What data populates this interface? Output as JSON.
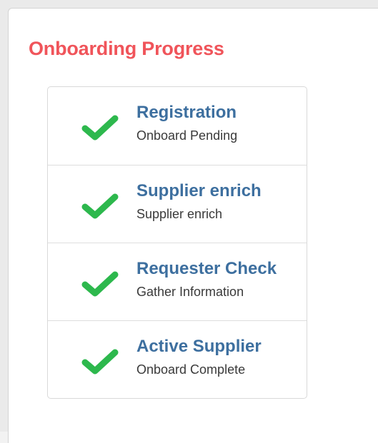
{
  "panel": {
    "title": "Onboarding Progress",
    "title_color": "#f0545a"
  },
  "steps": [
    {
      "title": "Registration",
      "status": "Onboard Pending",
      "icon": "check-icon",
      "completed": true
    },
    {
      "title": "Supplier enrich",
      "status": "Supplier enrich",
      "icon": "check-icon",
      "completed": true
    },
    {
      "title": "Requester Check",
      "status": "Gather Information",
      "icon": "check-icon",
      "completed": true
    },
    {
      "title": "Active Supplier",
      "status": "Onboard Complete",
      "icon": "check-icon",
      "completed": true
    }
  ],
  "colors": {
    "check": "#2db84d",
    "step_title": "#3d6f9f"
  }
}
